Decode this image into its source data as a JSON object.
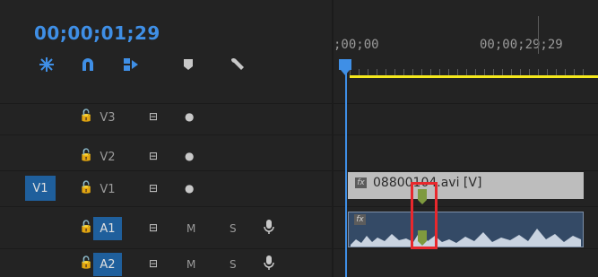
{
  "timecode": "00;00;01;29",
  "tools": [
    "snap-icon",
    "magnet-icon",
    "linked-selection-icon",
    "marker-icon",
    "wrench-icon"
  ],
  "ruler": {
    "start": ";00;00",
    "end": "00;00;29;29"
  },
  "tracks": [
    {
      "source": "",
      "name": "V3",
      "lock": "🔓",
      "sync": "⊟",
      "eye": "●",
      "selected": false
    },
    {
      "source": "",
      "name": "V2",
      "lock": "🔓",
      "sync": "⊟",
      "eye": "●",
      "selected": false
    },
    {
      "source": "V1",
      "name": "V1",
      "lock": "🔓",
      "sync": "⊟",
      "eye": "●",
      "selected": false
    },
    {
      "source": "",
      "name": "A1",
      "lock": "🔓",
      "sync": "⊟",
      "m": "M",
      "s": "S",
      "selected": true
    },
    {
      "source": "",
      "name": "A2",
      "lock": "🔓",
      "sync": "⊟",
      "m": "M",
      "s": "S",
      "selected": true
    }
  ],
  "clips": {
    "video_name": "08800104.avi [V]",
    "fx": "fx"
  },
  "colors": {
    "accent": "#3f8fe6",
    "yellow": "#f5e81d",
    "marker": "#7e9a3e",
    "highlight": "#e8282d"
  }
}
